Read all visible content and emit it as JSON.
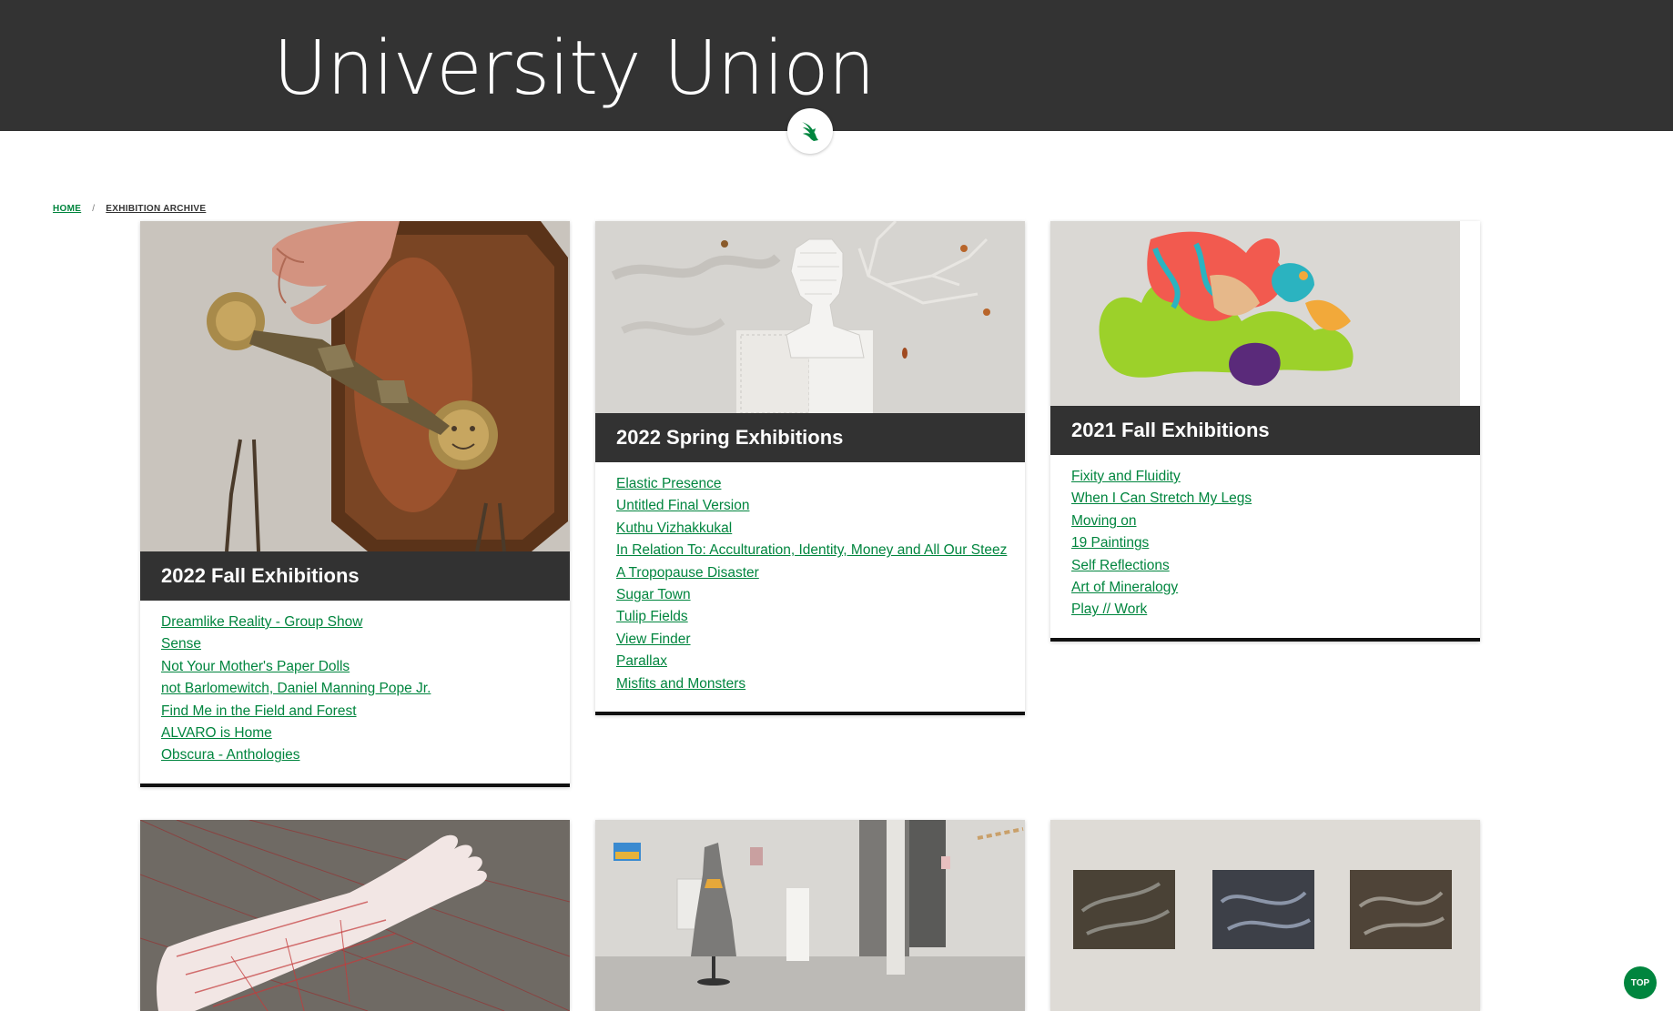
{
  "header": {
    "title": "University Union",
    "logo_icon": "eagle-logo-icon",
    "background": "#333333"
  },
  "breadcrumb": {
    "home": "HOME",
    "separator": "/",
    "current": "EXHIBITION ARCHIVE"
  },
  "cards": [
    {
      "title": "2022 Fall Exhibitions",
      "image": "sculpture-hand-sun-moon-image",
      "links": [
        "Dreamlike Reality - Group Show",
        "Sense",
        "Not Your Mother's Paper Dolls",
        "not Barlomewitch, Daniel Manning Pope Jr.",
        "Find Me in the Field and Forest",
        "ALVARO is Home",
        "Obscura - Anthologies"
      ]
    },
    {
      "title": "2022 Spring Exhibitions",
      "image": "pixel-bust-sculpture-image",
      "links": [
        "Elastic Presence",
        "Untitled Final Version",
        "Kuthu Vizhakkukal",
        "In Relation To: Acculturation, Identity, Money and All Our Steez",
        "A Tropopause Disaster",
        "Sugar Town",
        "Tulip Fields",
        "View Finder",
        "Parallax",
        "Misfits and Monsters"
      ]
    },
    {
      "title": "2021 Fall Exhibitions",
      "image": "colorful-abstract-shapes-image",
      "links": [
        "Fixity and Fluidity",
        "When I Can Stretch My Legs",
        "Moving on",
        "19 Paintings",
        "Self Reflections",
        "Art of Mineralogy",
        "Play // Work"
      ]
    }
  ],
  "bottom_images": [
    "red-thread-hand-sculpture-image",
    "gallery-dress-mannequin-image",
    "three-paintings-wall-image"
  ],
  "top_button": {
    "label": "TOP"
  },
  "colors": {
    "link": "#00853e",
    "title_bar": "#323232",
    "accent_green": "#00853e"
  }
}
